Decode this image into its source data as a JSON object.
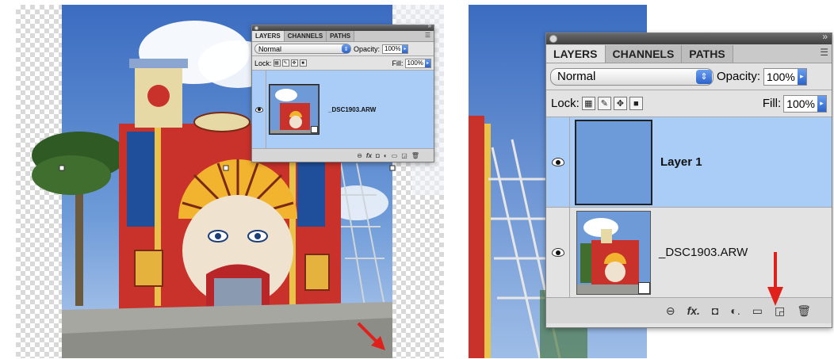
{
  "left_panel": {
    "tabs": [
      "LAYERS",
      "CHANNELS",
      "PATHS"
    ],
    "blend_mode": "Normal",
    "opacity_label": "Opacity:",
    "opacity_value": "100%",
    "lock_label": "Lock:",
    "fill_label": "Fill:",
    "fill_value": "100%",
    "layers": [
      {
        "name": "_DSC1903.ARW",
        "visible": true,
        "selected": true
      }
    ]
  },
  "right_panel": {
    "tabs": [
      "LAYERS",
      "CHANNELS",
      "PATHS"
    ],
    "blend_mode": "Normal",
    "opacity_label": "Opacity:",
    "opacity_value": "100%",
    "lock_label": "Lock:",
    "fill_label": "Fill:",
    "fill_value": "100%",
    "layers": [
      {
        "name": "Layer 1",
        "visible": true,
        "selected": true
      },
      {
        "name": "_DSC1903.ARW",
        "visible": true,
        "selected": false
      }
    ],
    "footer_icons": [
      "link-layers-icon",
      "fx-icon",
      "layer-mask-icon",
      "adjustment-layer-icon",
      "new-group-icon",
      "new-layer-icon",
      "trash-icon"
    ]
  },
  "colors": {
    "selected_layer": "#a9cdf6",
    "annotation_arrow": "#e0201b",
    "panel_bg": "#e3e3e3"
  }
}
